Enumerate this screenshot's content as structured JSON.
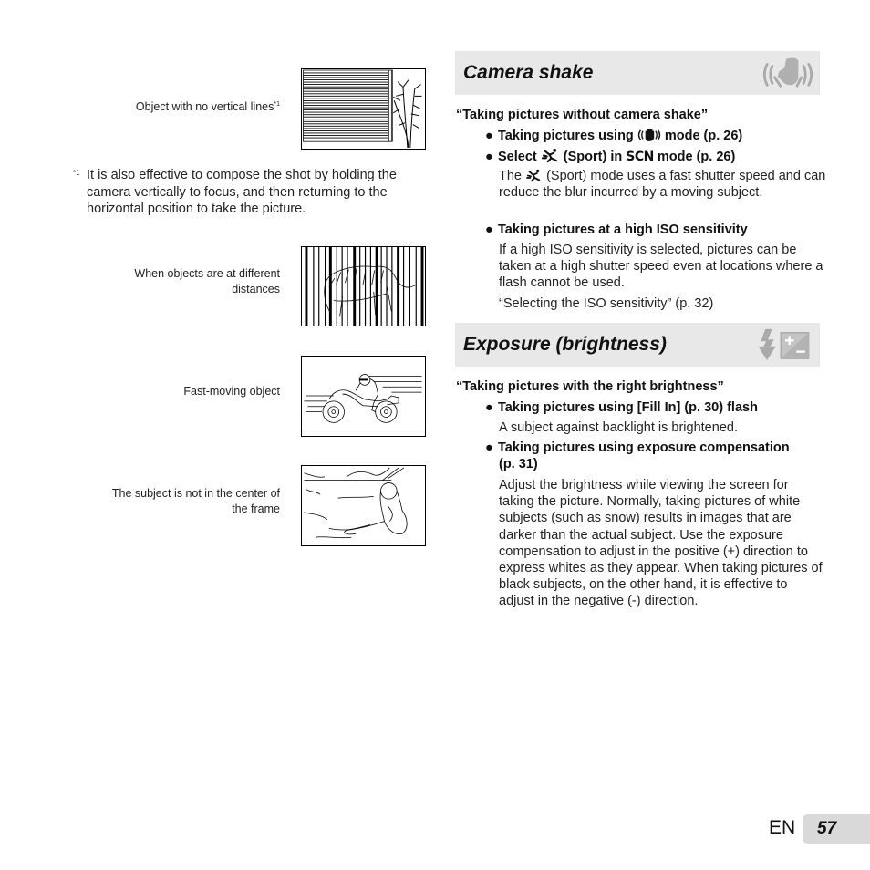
{
  "left_column": {
    "examples": [
      {
        "caption": "Object with no vertical lines",
        "footnote_ref": "*1",
        "illustration": "horizontal-blinds-with-bamboo"
      },
      {
        "caption_line1": "When objects are at different",
        "caption_line2": "distances",
        "illustration": "tiger-behind-bars"
      },
      {
        "caption": "Fast-moving object",
        "illustration": "motorcycle-racer"
      },
      {
        "caption_line1": "The subject is not in the center of",
        "caption_line2": "the frame",
        "illustration": "person-sitting-off-center"
      }
    ],
    "footnote": {
      "mark": "*1",
      "text": "It is also effective to compose the shot by holding the camera vertically to focus, and then returning to the horizontal position to take the picture."
    }
  },
  "sections": [
    {
      "title": "Camera shake",
      "icon": "shaking-hand-icon",
      "lead": "“Taking pictures without camera shake”",
      "items": [
        {
          "bullet": "●",
          "pre": "Taking pictures using",
          "icon": "digital-image-stabilization-icon",
          "post": "mode (p. 26)"
        },
        {
          "bullet": "●",
          "pre": "Select",
          "icon": "sport-icon",
          "mid": "(Sport) in",
          "scn": "SCN",
          "post": "mode (p. 26)",
          "desc_pre": "The",
          "desc_icon": "sport-icon",
          "desc_post": "(Sport) mode uses a fast shutter speed and can reduce the blur incurred by a moving subject."
        },
        {
          "bullet": "●",
          "text": "Taking pictures at a high ISO sensitivity",
          "desc": "If a high ISO sensitivity is selected, pictures can be taken at a high shutter speed even at locations where a flash cannot be used.",
          "ref": "“Selecting the ISO sensitivity” (p. 32)"
        }
      ]
    },
    {
      "title": "Exposure (brightness)",
      "icons": [
        "flash-icon",
        "exposure-compensation-icon"
      ],
      "lead": "“Taking pictures with the right brightness”",
      "items": [
        {
          "bullet": "●",
          "text": "Taking pictures using [Fill In] (p. 30) flash",
          "desc": "A subject against backlight is brightened."
        },
        {
          "bullet": "●",
          "text_line1": "Taking pictures using exposure compensation",
          "text_line2": "(p. 31)",
          "desc": "Adjust the brightness while viewing the screen for taking the picture. Normally, taking pictures of white subjects (such as snow) results in images that are darker than the actual subject. Use the exposure compensation to adjust in the positive (+) direction to express whites as they appear. When taking pictures of black subjects, on the other hand, it is effective to adjust in the negative (-) direction."
        }
      ]
    }
  ],
  "footer": {
    "language": "EN",
    "page_number": "57"
  },
  "colors": {
    "header_band": "#e8e8e8",
    "icon_gray": "#b3b3b3",
    "page_box": "#d9d9d9",
    "text": "#1a1a1a"
  }
}
